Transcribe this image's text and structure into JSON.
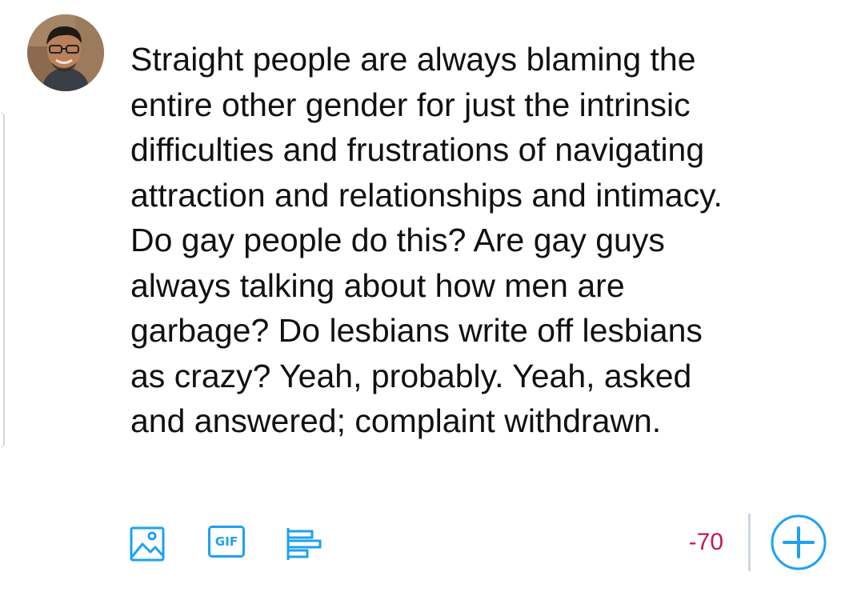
{
  "compose": {
    "lines": [
      "Straight people are always blaming the",
      "entire other gender for just the intrinsic",
      "difficulties and frustrations of navigating",
      "attraction and relationships and intimacy.",
      "Do gay people do this? Are gay guys",
      "always talking about how men are",
      "garbage? Do lesbians write off lesbians",
      "as crazy? Yeah, probably. Yeah, asked",
      "and answered; complaint withdrawn."
    ]
  },
  "toolbar": {
    "gif_label": "GIF",
    "char_count": "-70",
    "icons": [
      "image-icon",
      "gif-icon",
      "poll-icon",
      "plus-icon"
    ]
  },
  "colors": {
    "accent": "#1da1f2",
    "over_limit": "#c2185b",
    "text": "#111111",
    "divider": "#ccd6dd"
  }
}
